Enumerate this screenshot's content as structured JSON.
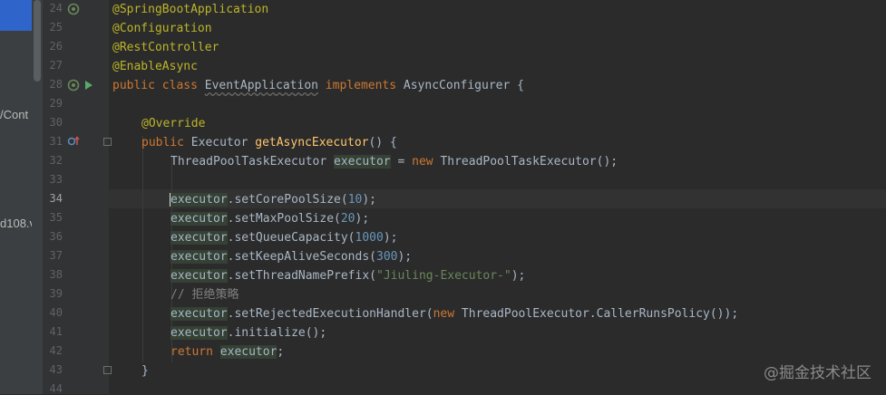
{
  "project_panel": {
    "fragment_1": "/Cont",
    "fragment_2": "d108.v"
  },
  "editor": {
    "current_line": 34,
    "line_numbers": [
      "24",
      "25",
      "26",
      "27",
      "28",
      "29",
      "30",
      "31",
      "32",
      "33",
      "34",
      "35",
      "36",
      "37",
      "38",
      "39",
      "40",
      "41",
      "42",
      "43",
      "44"
    ],
    "code": {
      "l24": "@SpringBootApplication",
      "l25": "@Configuration",
      "l26": "@RestController",
      "l27": "@EnableAsync",
      "l28": {
        "kw1": "public class ",
        "cls": "EventApplication",
        "kw2": " implements ",
        "rest": "AsyncConfigurer {"
      },
      "l30": "@Override",
      "l31": {
        "kw": "public ",
        "type": "Executor ",
        "fn": "getAsyncExecutor",
        "rest": "() {"
      },
      "l32": {
        "type": "ThreadPoolTaskExecutor ",
        "var": "executor",
        "eq": " = ",
        "kw": "new ",
        "rest": "ThreadPoolTaskExecutor();"
      },
      "l34": {
        "caret_char": "e",
        "var": "xecutor",
        "call": ".setCorePoolSize(",
        "num": "10",
        "end": ");"
      },
      "l35": {
        "var": "executor",
        "call": ".setMaxPoolSize(",
        "num": "20",
        "end": ");"
      },
      "l36": {
        "var": "executor",
        "call": ".setQueueCapacity(",
        "num": "1000",
        "end": ");"
      },
      "l37": {
        "var": "executor",
        "call": ".setKeepAliveSeconds(",
        "num": "300",
        "end": ");"
      },
      "l38": {
        "var": "executor",
        "call": ".setThreadNamePrefix(",
        "str": "\"Jiuling-Executor-\"",
        "end": ");"
      },
      "l39": "// 拒绝策略",
      "l40": {
        "var": "executor",
        "call": ".setRejectedExecutionHandler(",
        "kw": "new ",
        "rest": "ThreadPoolExecutor.CallerRunsPolicy());"
      },
      "l41": {
        "var": "executor",
        "rest": ".initialize();"
      },
      "l42": {
        "kw": "return ",
        "var": "executor",
        "end": ";"
      },
      "l43": "}"
    }
  },
  "watermark": "@掘金技术社区",
  "colors": {
    "background": "#2b2b2b",
    "gutter": "#313335",
    "annotation": "#bbb529",
    "keyword": "#cc7832",
    "method": "#ffc66d",
    "number": "#6897bb",
    "string": "#6a8759",
    "comment": "#808080",
    "text": "#a9b7c6"
  },
  "icons": {
    "l24": "spring-bean-icon",
    "l28_a": "spring-bean-icon",
    "l28_b": "run-icon",
    "l31": "override-icon"
  }
}
